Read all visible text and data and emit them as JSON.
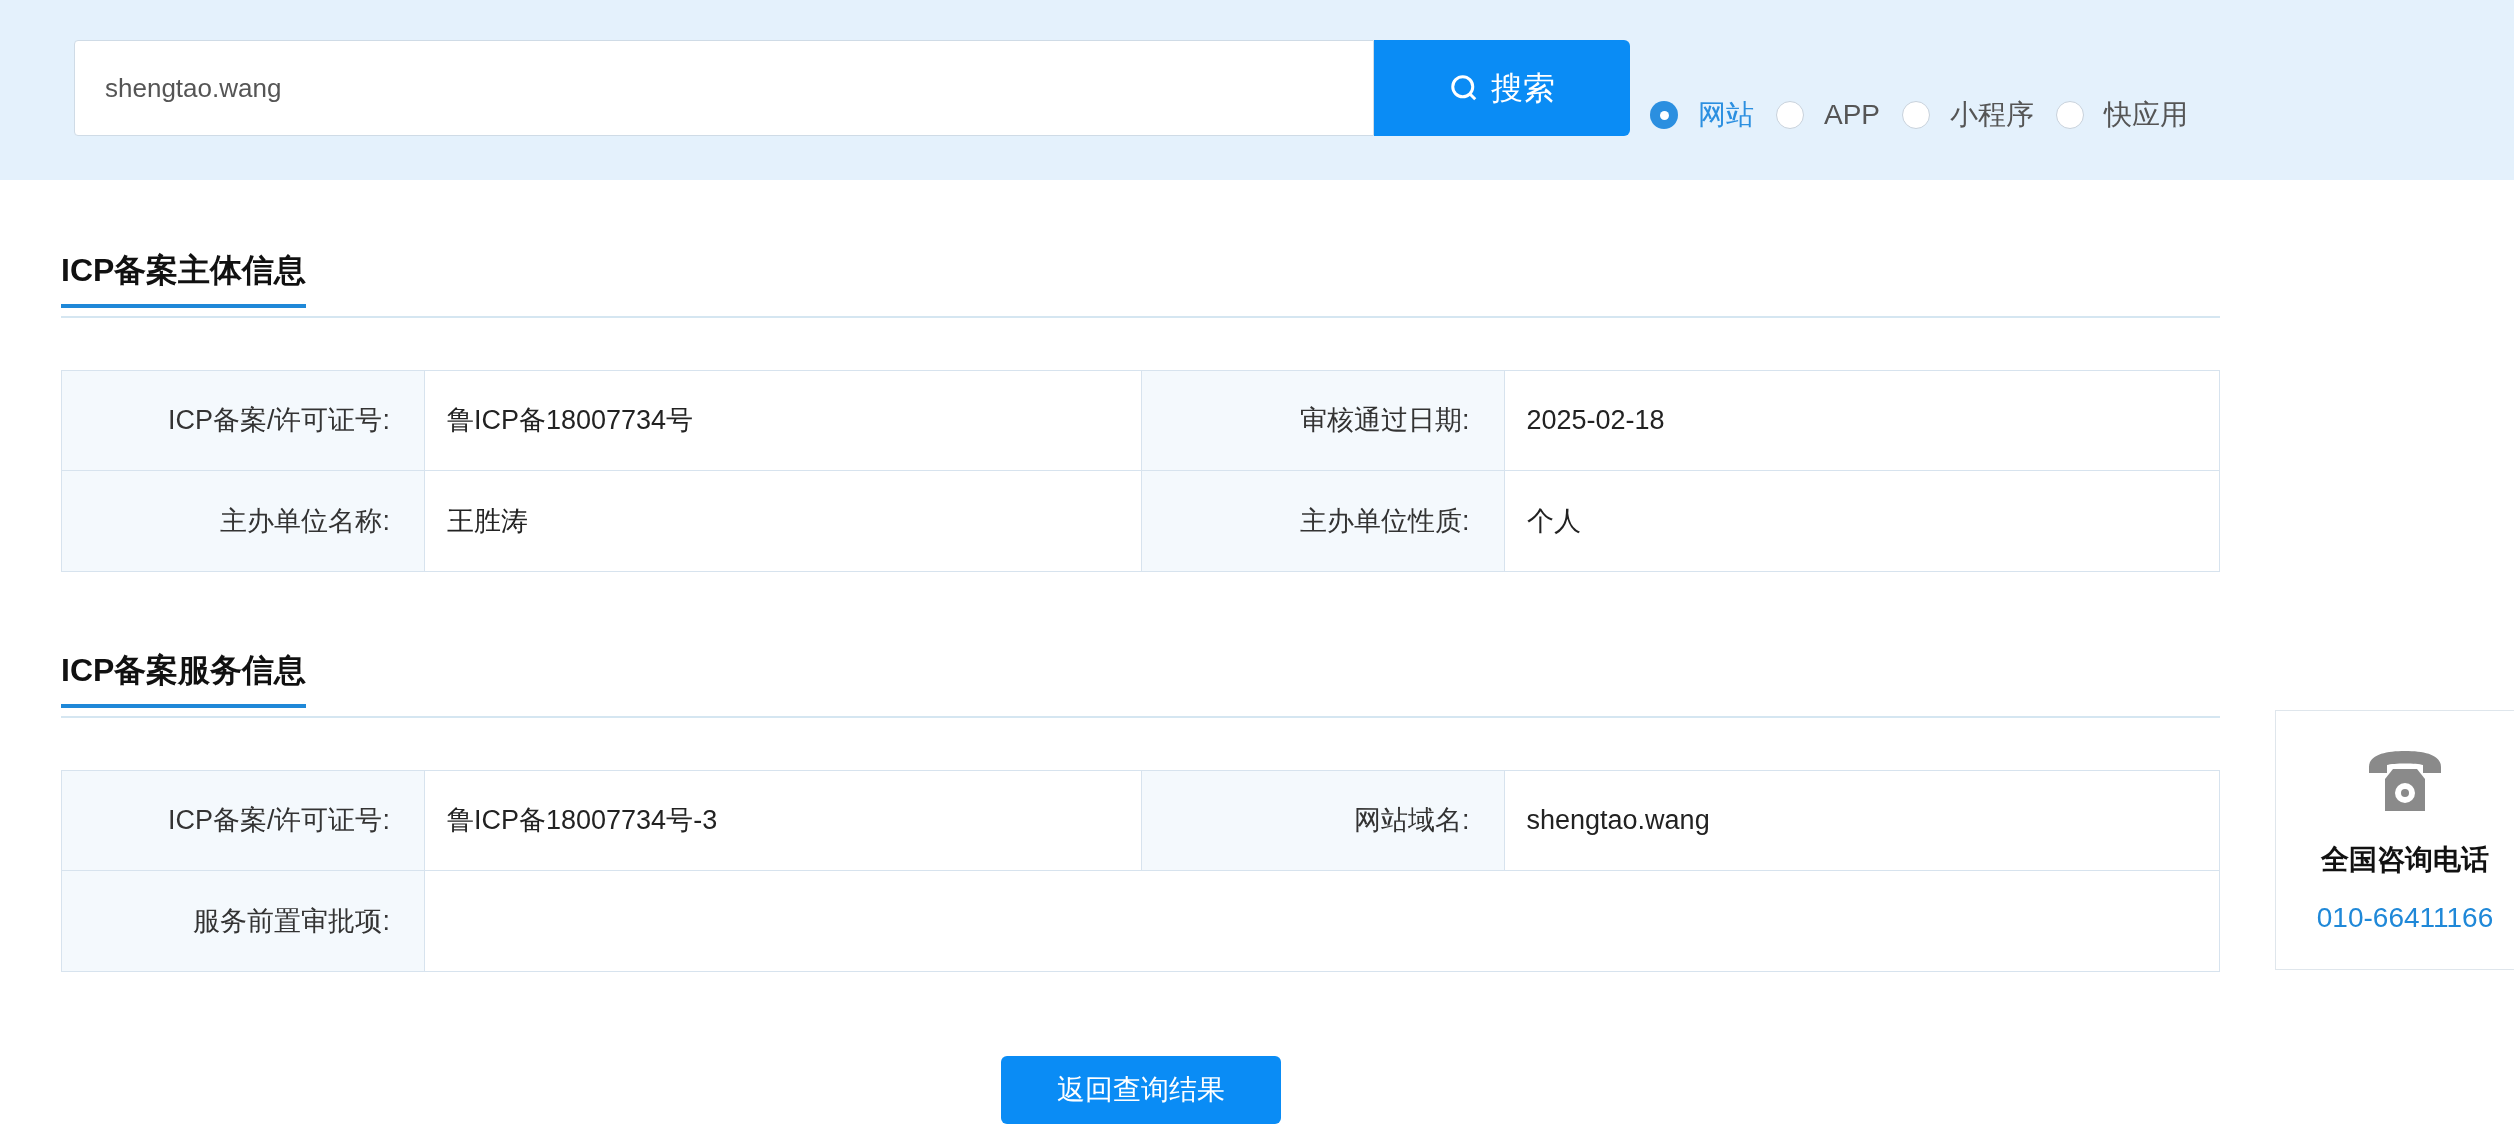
{
  "search": {
    "value": "shengtao.wang",
    "button": "搜索"
  },
  "types": [
    {
      "label": "网站",
      "selected": true
    },
    {
      "label": "APP",
      "selected": false
    },
    {
      "label": "小程序",
      "selected": false
    },
    {
      "label": "快应用",
      "selected": false
    }
  ],
  "sections": [
    {
      "title": "ICP备案主体信息",
      "rows": [
        [
          {
            "label": "ICP备案/许可证号:",
            "value": "鲁ICP备18007734号"
          },
          {
            "label": "审核通过日期:",
            "value": "2025-02-18"
          }
        ],
        [
          {
            "label": "主办单位名称:",
            "value": "王胜涛"
          },
          {
            "label": "主办单位性质:",
            "value": "个人"
          }
        ]
      ]
    },
    {
      "title": "ICP备案服务信息",
      "rows": [
        [
          {
            "label": "ICP备案/许可证号:",
            "value": "鲁ICP备18007734号-3"
          },
          {
            "label": "网站域名:",
            "value": "shengtao.wang"
          }
        ],
        [
          {
            "label": "服务前置审批项:"
          }
        ]
      ]
    }
  ],
  "back_button": "返回查询结果",
  "hotline": {
    "title": "全国咨询电话",
    "phone": "010-66411166"
  }
}
